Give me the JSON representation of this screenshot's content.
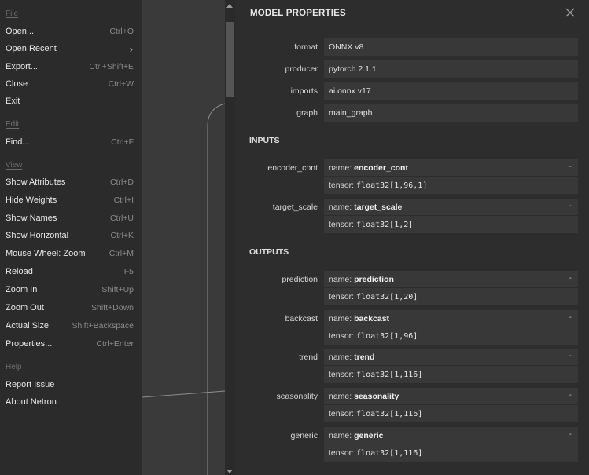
{
  "menu": {
    "groups": [
      {
        "label": "File",
        "items": [
          {
            "label": "Open...",
            "shortcut": "Ctrl+O"
          },
          {
            "label": "Open Recent",
            "shortcut": ""
          },
          {
            "label": "Export...",
            "shortcut": "Ctrl+Shift+E"
          },
          {
            "label": "Close",
            "shortcut": "Ctrl+W"
          },
          {
            "label": "Exit",
            "shortcut": ""
          }
        ]
      },
      {
        "label": "Edit",
        "items": [
          {
            "label": "Find...",
            "shortcut": "Ctrl+F"
          }
        ]
      },
      {
        "label": "View",
        "items": [
          {
            "label": "Show Attributes",
            "shortcut": "Ctrl+D"
          },
          {
            "label": "Hide Weights",
            "shortcut": "Ctrl+I"
          },
          {
            "label": "Show Names",
            "shortcut": "Ctrl+U"
          },
          {
            "label": "Show Horizontal",
            "shortcut": "Ctrl+K"
          },
          {
            "label": "Mouse Wheel: Zoom",
            "shortcut": "Ctrl+M"
          },
          {
            "label": "Reload",
            "shortcut": "F5"
          },
          {
            "label": "Zoom In",
            "shortcut": "Shift+Up"
          },
          {
            "label": "Zoom Out",
            "shortcut": "Shift+Down"
          },
          {
            "label": "Actual Size",
            "shortcut": "Shift+Backspace"
          },
          {
            "label": "Properties...",
            "shortcut": "Ctrl+Enter"
          }
        ]
      },
      {
        "label": "Help",
        "items": [
          {
            "label": "Report Issue",
            "shortcut": ""
          },
          {
            "label": "About Netron",
            "shortcut": ""
          }
        ]
      }
    ],
    "submenu_chevron": "›"
  },
  "panel": {
    "title": "MODEL PROPERTIES",
    "close_symbol": "×",
    "properties": [
      {
        "key": "format",
        "value": "ONNX v8"
      },
      {
        "key": "producer",
        "value": "pytorch 2.1.1"
      },
      {
        "key": "imports",
        "value": "ai.onnx v17"
      },
      {
        "key": "graph",
        "value": "main_graph"
      }
    ],
    "inputs_heading": "INPUTS",
    "outputs_heading": "OUTPUTS",
    "name_prefix": "name: ",
    "tensor_prefix": "tensor: ",
    "collapse_symbol": "-",
    "inputs": [
      {
        "key": "encoder_cont",
        "name": "encoder_cont",
        "tensor": "float32[1,96,1]"
      },
      {
        "key": "target_scale",
        "name": "target_scale",
        "tensor": "float32[1,2]"
      }
    ],
    "outputs": [
      {
        "key": "prediction",
        "name": "prediction",
        "tensor": "float32[1,20]"
      },
      {
        "key": "backcast",
        "name": "backcast",
        "tensor": "float32[1,96]"
      },
      {
        "key": "trend",
        "name": "trend",
        "tensor": "float32[1,116]"
      },
      {
        "key": "seasonality",
        "name": "seasonality",
        "tensor": "float32[1,116]"
      },
      {
        "key": "generic",
        "name": "generic",
        "tensor": "float32[1,116]"
      }
    ]
  },
  "colors": {
    "menu_bg": "#2b2b2b",
    "canvas_bg": "#3a3a3a",
    "panel_bg": "#2d2d2d",
    "value_box_bg": "#383838",
    "edge_stroke": "#8c8c8c"
  }
}
